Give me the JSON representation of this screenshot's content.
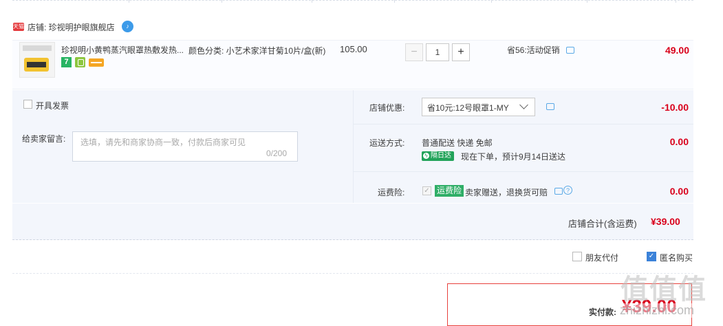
{
  "shop": {
    "badge": "天猫",
    "label": "店铺: 珍视明护眼旗舰店",
    "ww_icon": "chat-bubble-icon"
  },
  "item": {
    "title": "珍视明小黄鸭蒸汽眼罩热敷发热...",
    "sku": "颜色分类: 小艺术家洋甘菊10片/盒(新)",
    "price": "105.00",
    "qty": "1",
    "qty_minus": "−",
    "qty_plus": "+",
    "badge_7": "7",
    "promo": "省56:活动促销",
    "subtotal": "49.00"
  },
  "options": {
    "invoice_label": "开具发票",
    "message_label": "给卖家留言:",
    "message_placeholder": "选填，请先和商家协商一致，付款后商家可见",
    "message_count": "0/200",
    "coupon_label": "店铺优惠:",
    "coupon_value": "省10元:12号眼罩1-MY",
    "coupon_amount": "-10.00",
    "ship_label": "运送方式:",
    "ship_method": "普通配送 快递 免邮",
    "next_day_tag": "隔日达",
    "ship_eta": "现在下单，预计9月14日送达",
    "ship_amount": "0.00",
    "insurance_label": "运费险:",
    "insurance_tag": "运费险",
    "insurance_text": "卖家赠送，退换货可赔",
    "insurance_help": "?",
    "insurance_amount": "0.00"
  },
  "total": {
    "label": "店铺合计(含运费)",
    "amount": "¥39.00"
  },
  "payment_options": {
    "friend_pay": "朋友代付",
    "anonymous": "匿名购买",
    "anonymous_checked": true
  },
  "pay": {
    "label": "实付款:",
    "amount": "¥39.00"
  },
  "watermark": {
    "logo": "值值值",
    "url": "zhizhizhi.com"
  },
  "colors": {
    "price_red": "#d9001b",
    "panel_bg": "#f3f6fc",
    "check_blue": "#3b82d9",
    "green_tag": "#2fae67"
  }
}
